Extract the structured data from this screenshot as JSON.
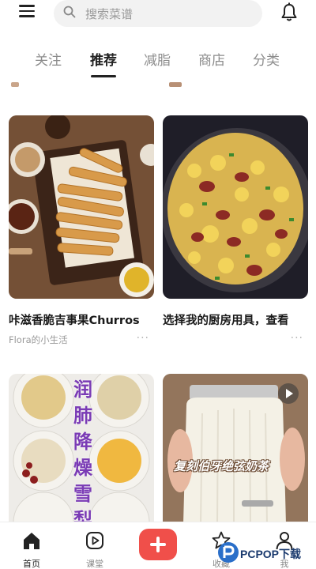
{
  "search": {
    "placeholder": "搜索菜谱"
  },
  "tabs": [
    {
      "label": "关注"
    },
    {
      "label": "推荐"
    },
    {
      "label": "减脂"
    },
    {
      "label": "商店"
    },
    {
      "label": "分类"
    }
  ],
  "active_tab": "推荐",
  "cards": [
    {
      "title": "咔滋香脆吉事果Churros",
      "author": "Flora的小生活",
      "more": "···"
    },
    {
      "title": "选择我的厨房用具，查看",
      "author": "",
      "more": "···"
    },
    {
      "title": "",
      "author": "",
      "overlay_text": [
        "润",
        "肺",
        "降",
        "燥",
        "雪",
        "梨"
      ]
    },
    {
      "title": "",
      "author": "",
      "overlay_text": "复刻伯牙绝弦奶茶"
    }
  ],
  "bottom_nav": [
    {
      "label": "首页",
      "icon": "home-icon"
    },
    {
      "label": "课堂",
      "icon": "play-icon"
    },
    {
      "label": "",
      "icon": "add-icon"
    },
    {
      "label": "收藏",
      "icon": "star-icon"
    },
    {
      "label": "我",
      "icon": "person-icon"
    }
  ],
  "colors": {
    "accent": "#f04f4a",
    "text": "#222222",
    "muted": "#9a9a9a"
  },
  "watermark": {
    "text": "PCPOP下载"
  }
}
